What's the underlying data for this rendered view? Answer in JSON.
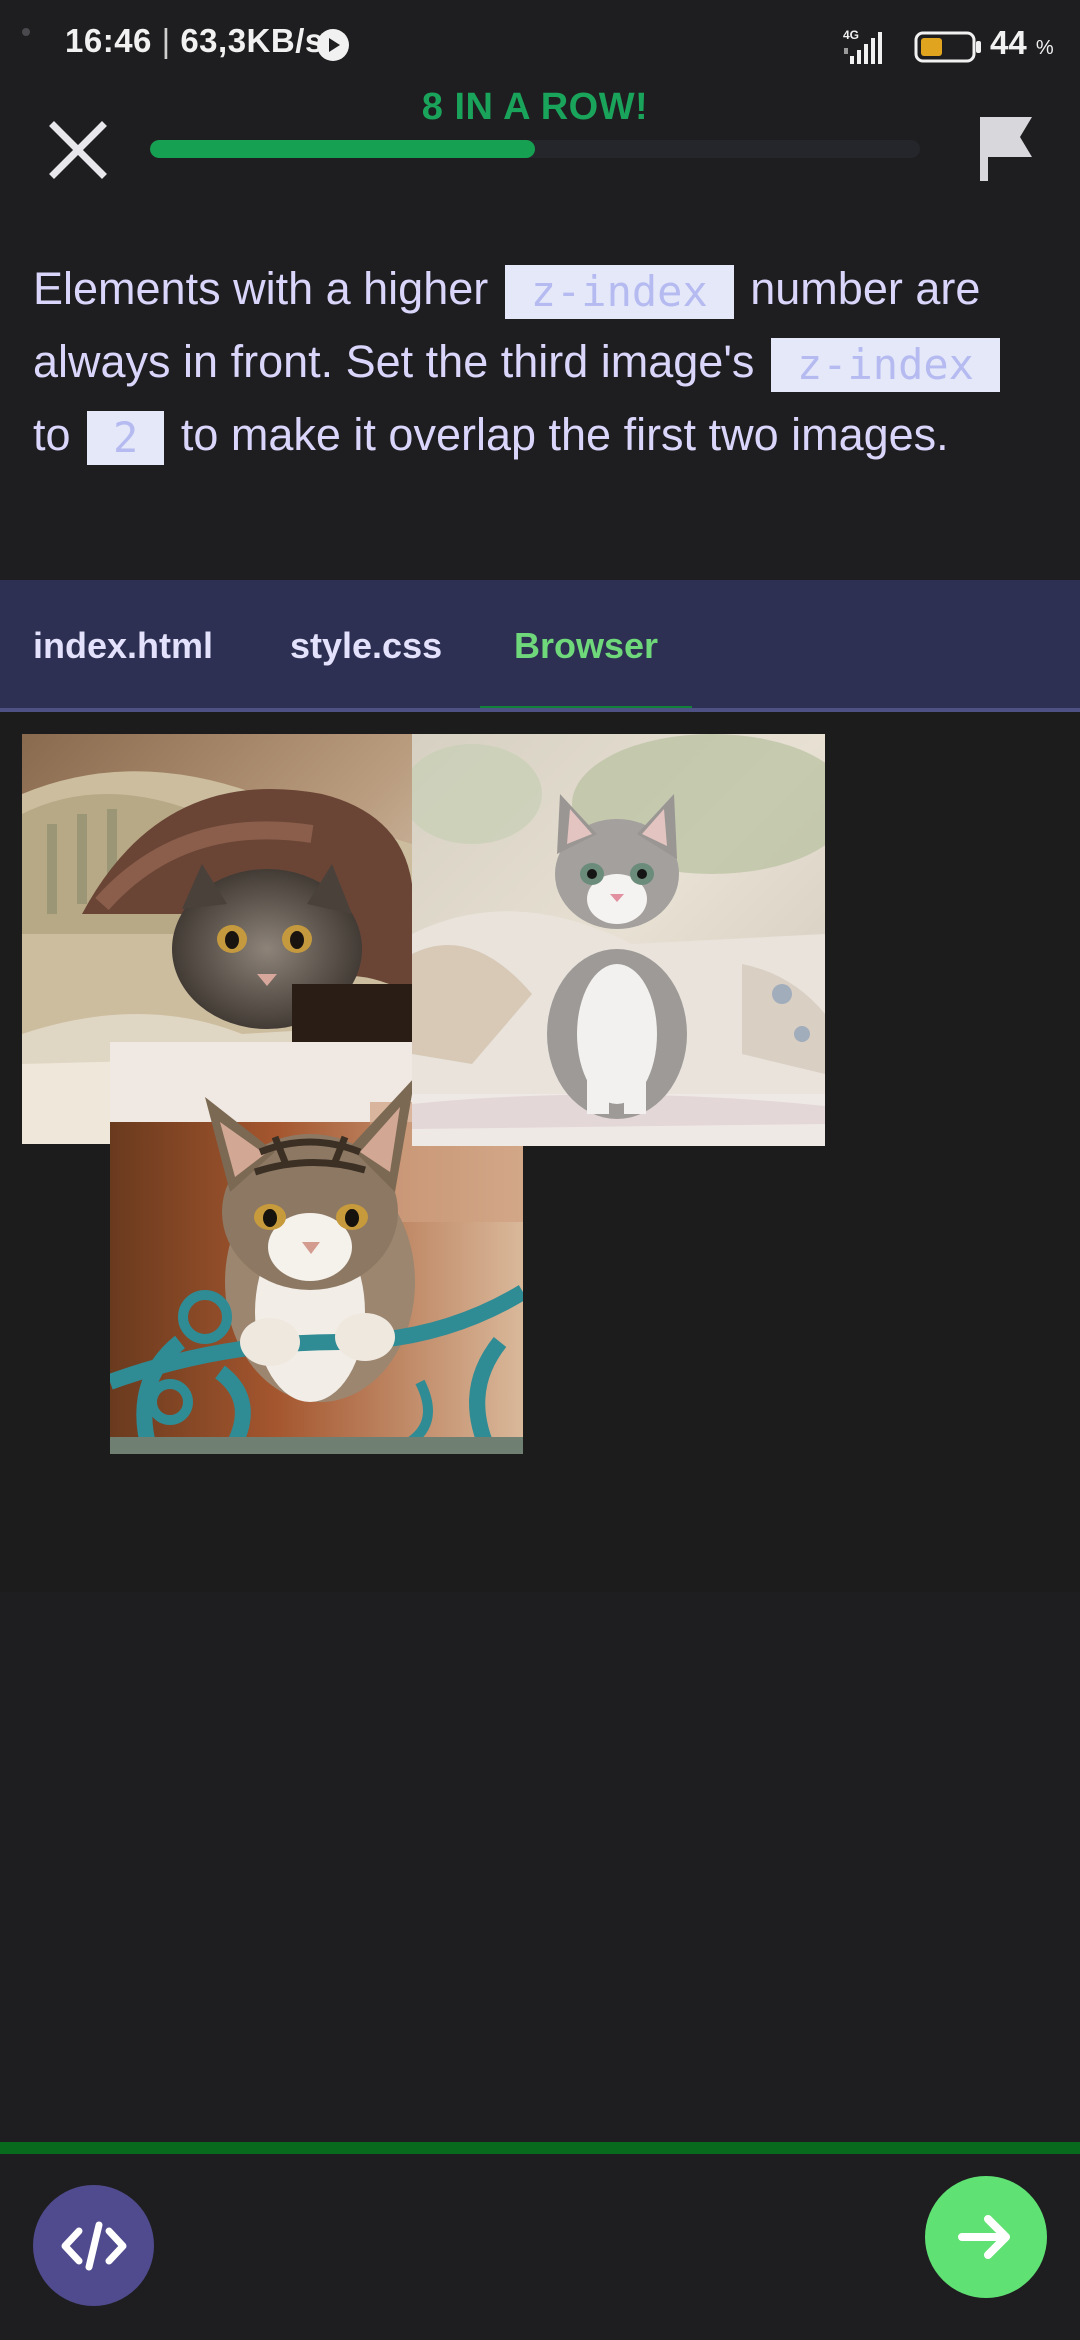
{
  "status_bar": {
    "time": "16:46",
    "separator": " | ",
    "speed": "63,3KB/s",
    "network_label": "4G",
    "battery_percent": "44",
    "battery_unit": "%",
    "battery_level": 0.44,
    "battery_color": "#e0a41e"
  },
  "header": {
    "streak_text": "8 IN A ROW!",
    "progress_fraction": 0.5,
    "progress_color": "#16a052"
  },
  "instructions": {
    "part1": "Elements with a higher ",
    "code1": "z-index",
    "part2": " number are always in front. Set the third image's ",
    "code2": "z-index",
    "part3": " to ",
    "code3": "2",
    "part4": " to make it overlap the first two images."
  },
  "tabs": [
    {
      "label": "index.html",
      "active": false
    },
    {
      "label": "style.css",
      "active": false
    },
    {
      "label": "Browser",
      "active": true
    }
  ],
  "icons": {
    "close": "close-icon",
    "flag": "flag-icon",
    "code": "code-icon",
    "next": "arrow-right-icon"
  },
  "colors": {
    "accent_green": "#5fe173",
    "tab_bar": "#2d3052",
    "code_button": "#4f4b8e"
  }
}
